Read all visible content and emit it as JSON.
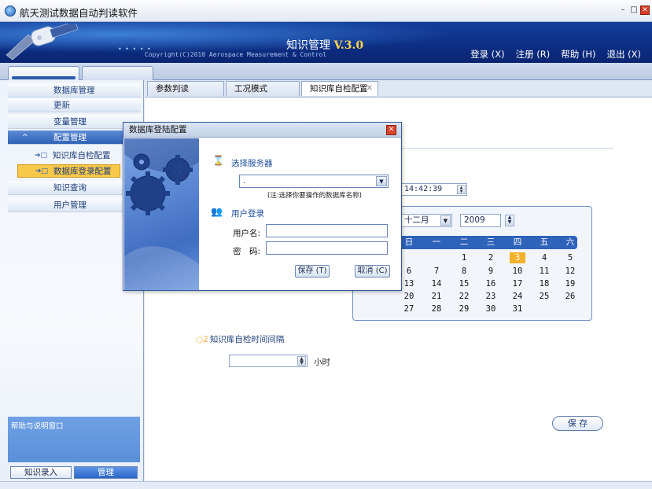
{
  "window": {
    "title": "航天测试数据自动判读软件",
    "controls": [
      "–",
      "□",
      "✕"
    ]
  },
  "banner": {
    "product": "知识管理",
    "version": "V.3.0",
    "copyright": "Copyright(C)2010 Aerospace Measurement & Control",
    "nav": {
      "login": "登录 (X)",
      "register": "注册 (R)",
      "help": "帮助 (H)",
      "exit": "退出 (X)"
    }
  },
  "sidebar": {
    "items": [
      {
        "label": "数据库管理"
      },
      {
        "label": "更新"
      },
      {
        "label": "变量管理"
      },
      {
        "label": "配置管理"
      },
      {
        "label": "知识查询"
      },
      {
        "label": "用户管理"
      }
    ],
    "subitems": [
      {
        "label": "知识库自检配置"
      },
      {
        "label": "数据库登录配置"
      }
    ],
    "help_panel": "帮助与说明窗口",
    "bottom_buttons": {
      "entry": "知识录入",
      "manage": "管理"
    }
  },
  "tabs": [
    {
      "label": "参数判读"
    },
    {
      "label": "工况模式"
    },
    {
      "label": "知识库自检配置"
    }
  ],
  "config": {
    "time_value": "14:42:39",
    "interval_label": "知识库自检时间间隔",
    "interval_value": "",
    "interval_unit": "小时",
    "save_label": "保 存"
  },
  "calendar": {
    "month": "十二月",
    "year": "2009",
    "weekdays": [
      "日",
      "一",
      "二",
      "三",
      "四",
      "五",
      "六"
    ],
    "days": [
      [
        "",
        "",
        "1",
        "2",
        "3",
        "4",
        "5"
      ],
      [
        "6",
        "7",
        "8",
        "9",
        "10",
        "11",
        "12"
      ],
      [
        "13",
        "14",
        "15",
        "16",
        "17",
        "18",
        "19"
      ],
      [
        "20",
        "21",
        "22",
        "23",
        "24",
        "25",
        "26"
      ],
      [
        "27",
        "28",
        "29",
        "30",
        "31",
        "",
        ""
      ]
    ],
    "today": "3"
  },
  "dialog": {
    "title": "数据库登陆配置",
    "select_server_label": "选择服务器",
    "server_value": ".",
    "server_note": "(注:选择你要操作的数据库名称)",
    "user_login_label": "用户登录",
    "username_label": "用户名:",
    "username_value": "",
    "password_label": "密　码:",
    "password_value": "",
    "save_button": "保存 (T)",
    "cancel_button": "取消 (C)"
  },
  "colors": {
    "banner": "#0d2f86",
    "accent": "#2f63b9",
    "highlight": "#f8c84a",
    "today": "#f3b22a"
  }
}
